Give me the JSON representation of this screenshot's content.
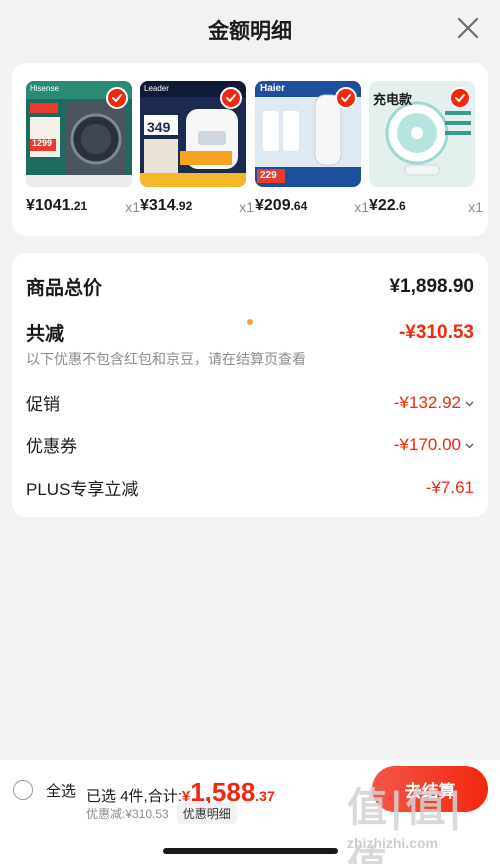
{
  "header": {
    "title": "金额明细"
  },
  "products": [
    {
      "price_int": "¥1041",
      "price_dec": ".21",
      "qty": "x1"
    },
    {
      "price_int": "¥314",
      "price_dec": ".92",
      "qty": "x1"
    },
    {
      "price_int": "¥209",
      "price_dec": ".64",
      "qty": "x1"
    },
    {
      "price_int": "¥22",
      "price_dec": ".6",
      "qty": "x1"
    }
  ],
  "product_images": [
    {
      "badge_text": "1299",
      "tag": "Hisense"
    },
    {
      "badge_text": "349",
      "tag": "Leader"
    },
    {
      "badge_text": "229",
      "tag": "Haier"
    },
    {
      "badge_text": "充电款",
      "tag": ""
    }
  ],
  "summary": {
    "total_label": "商品总价",
    "total_value": "¥1,898.90",
    "reduce_label": "共减",
    "reduce_value": "-¥310.53",
    "note": "以下优惠不包含红包和京豆，请在结算页查看",
    "promo_label": "促销",
    "promo_value": "-¥132.92",
    "coupon_label": "优惠券",
    "coupon_value": "-¥170.00",
    "plus_label": "PLUS专享立减",
    "plus_value": "-¥7.61"
  },
  "bottom": {
    "select_all": "全选",
    "selected_prefix": "已选",
    "selected_count": "4",
    "selected_suffix": "件,合计:",
    "yen": "¥",
    "total_int": "1,588",
    "total_dec": ".37",
    "discount_text": "优惠减:¥310.53",
    "detail_label": "优惠明细",
    "checkout_label": "去结算"
  },
  "watermark": {
    "logo": "值|值|值",
    "url": "zhizhizhi.com"
  },
  "colors": {
    "accent": "#f2270c",
    "background": "#f2f2f2"
  }
}
